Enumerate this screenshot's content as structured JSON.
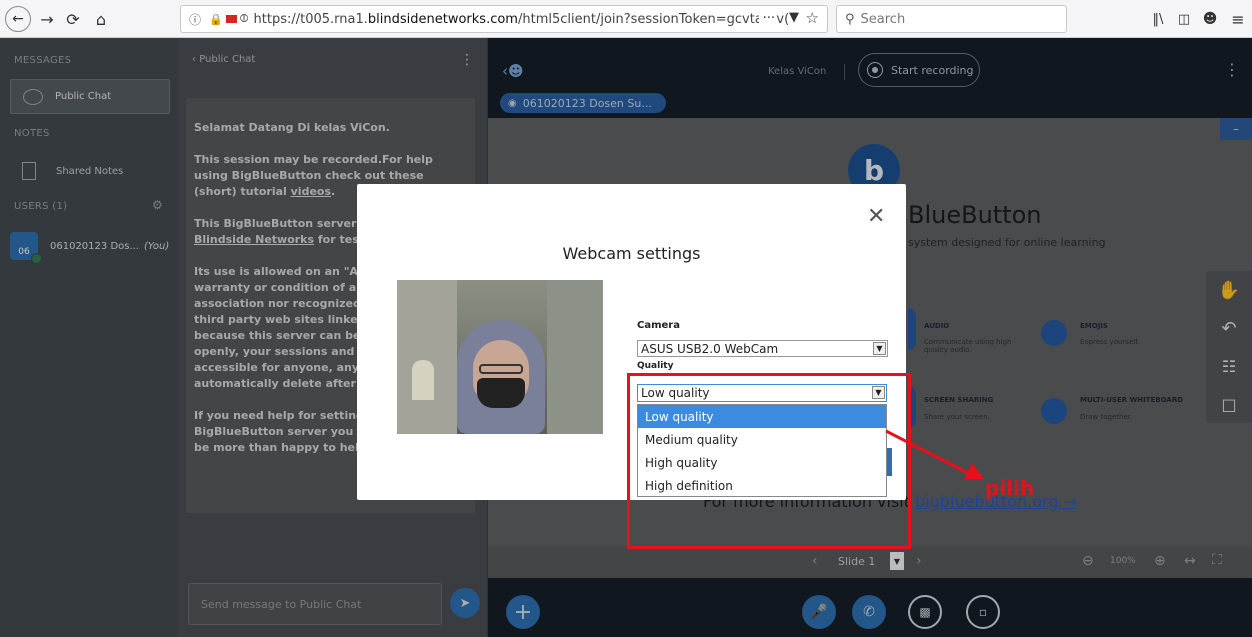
{
  "browser": {
    "url": "https://t005.rna1.blindsidenetworks.com/html5client/join?sessionToken=gcvtar2v(",
    "url_domain": "blindsidenetworks.com",
    "url_prefix": "https://t005.rna1.",
    "url_suffix": "/html5client/join?sessionToken=gcvtar2v(",
    "search_placeholder": "Search",
    "more_icon": "···"
  },
  "sidebar": {
    "messages_title": "MESSAGES",
    "public_chat": "Public Chat",
    "notes_title": "NOTES",
    "shared_notes": "Shared Notes",
    "users_title": "USERS (1)",
    "user_name": "061020123 Dos...",
    "user_you": "(You)",
    "avatar_initials": "06"
  },
  "chat": {
    "header": "Public Chat",
    "messages": [
      "Selamat Datang Di kelas ViCon.",
      "This session may be recorded.For help using BigBlueButton check out these (short) tutorial videos.",
      "This BigBlueButton server is provided by Blindside Networks for testi",
      "Its use is allowed on an \"AS IS\" warranty or condition of any association nor recognized re third party web sites linked t because this server can be us openly, your sessions and rec accessible for anyone, anytin automatically delete after 7 d",
      "If you need help for setting u BigBlueButton server you ca be more than happy to help."
    ],
    "input_placeholder": "Send message to Public Chat"
  },
  "topbar": {
    "meeting_name": "Kelas ViCon",
    "record_label": "Start recording",
    "talker": "061020123 Dosen Su..."
  },
  "presentation": {
    "brand_title": "BlueButton",
    "brand_subtitle": "system designed for online learning",
    "features": [
      {
        "title": "AUDIO",
        "desc": "Communicate using high quality audio."
      },
      {
        "title": "EMOJIS",
        "desc": "Express yourself."
      },
      {
        "title": "SCREEN SHARING",
        "desc": "Share your screen."
      },
      {
        "title": "MULTI-USER WHITEBOARD",
        "desc": "Draw together."
      }
    ],
    "more_info_prefix": "For more information visit ",
    "more_info_link": "bigbluebutton.org →",
    "slide_label": "Slide 1",
    "zoom": "100%"
  },
  "modal": {
    "title": "Webcam settings",
    "camera_label": "Camera",
    "camera_value": "ASUS USB2.0 WebCam",
    "quality_label": "Quality",
    "quality_value": "Low quality",
    "quality_options": [
      "Low quality",
      "Medium quality",
      "High quality",
      "High definition"
    ]
  },
  "annotation": {
    "label": "pilih",
    "color": "#e8101a"
  },
  "colors": {
    "accent": "#2d6fb0",
    "dropdown_highlight": "#3d8be0"
  }
}
